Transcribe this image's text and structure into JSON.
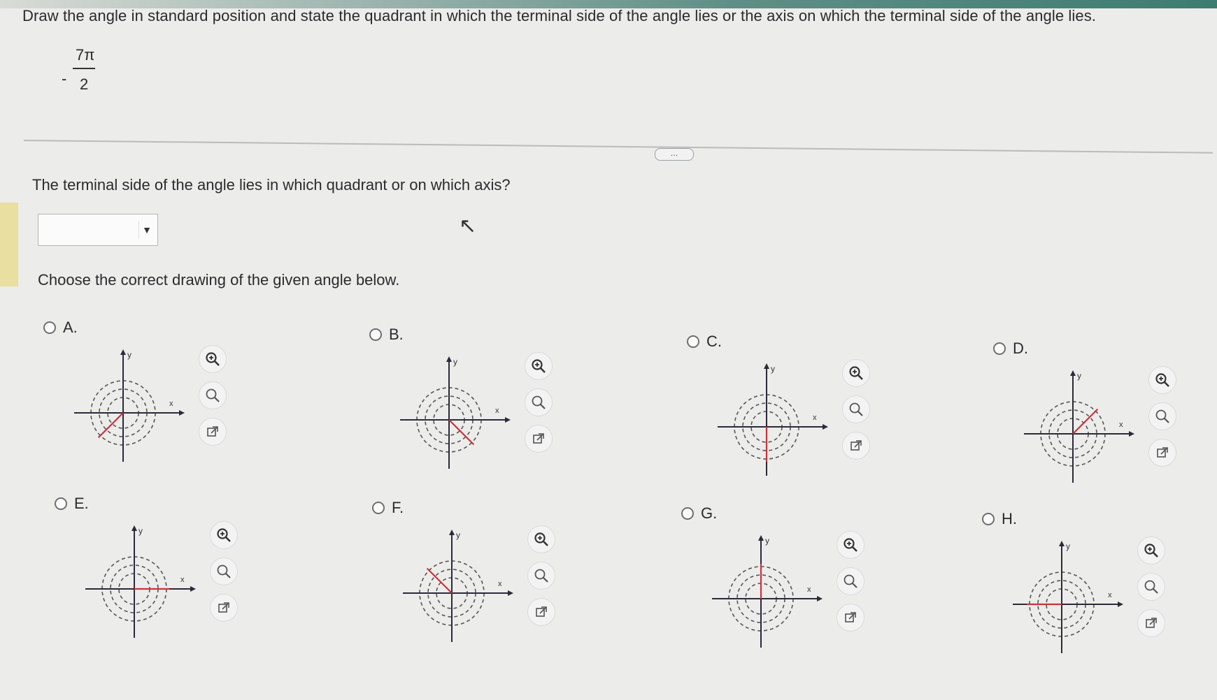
{
  "question": {
    "text": "Draw the angle in standard position and state the quadrant in which the terminal side of the angle lies or the axis on which the terminal side of the angle lies.",
    "angle": {
      "sign": "-",
      "numerator": "7π",
      "denominator": "2"
    }
  },
  "more_button": "...",
  "part1": {
    "prompt": "The terminal side of the angle lies in which quadrant or on which axis?",
    "dropdown_value": "",
    "dropdown_arrow": "▼"
  },
  "part2": {
    "prompt": "Choose the correct drawing of the given angle below."
  },
  "axis_labels": {
    "x": "x",
    "y": "y"
  },
  "colors": {
    "terminal_side": "#c8333a",
    "axes": "#2a2a3a",
    "spiral": "#555"
  },
  "options": [
    {
      "label": "A.",
      "ray_angle_deg": 225
    },
    {
      "label": "B.",
      "ray_angle_deg": 315
    },
    {
      "label": "C.",
      "ray_angle_deg": 270
    },
    {
      "label": "D.",
      "ray_angle_deg": 45
    },
    {
      "label": "E.",
      "ray_angle_deg": 0
    },
    {
      "label": "F.",
      "ray_angle_deg": 135
    },
    {
      "label": "G.",
      "ray_angle_deg": 90
    },
    {
      "label": "H.",
      "ray_angle_deg": 180
    }
  ],
  "icons": [
    "zoom-in-icon",
    "zoom-out-icon",
    "open-new-window-icon"
  ]
}
